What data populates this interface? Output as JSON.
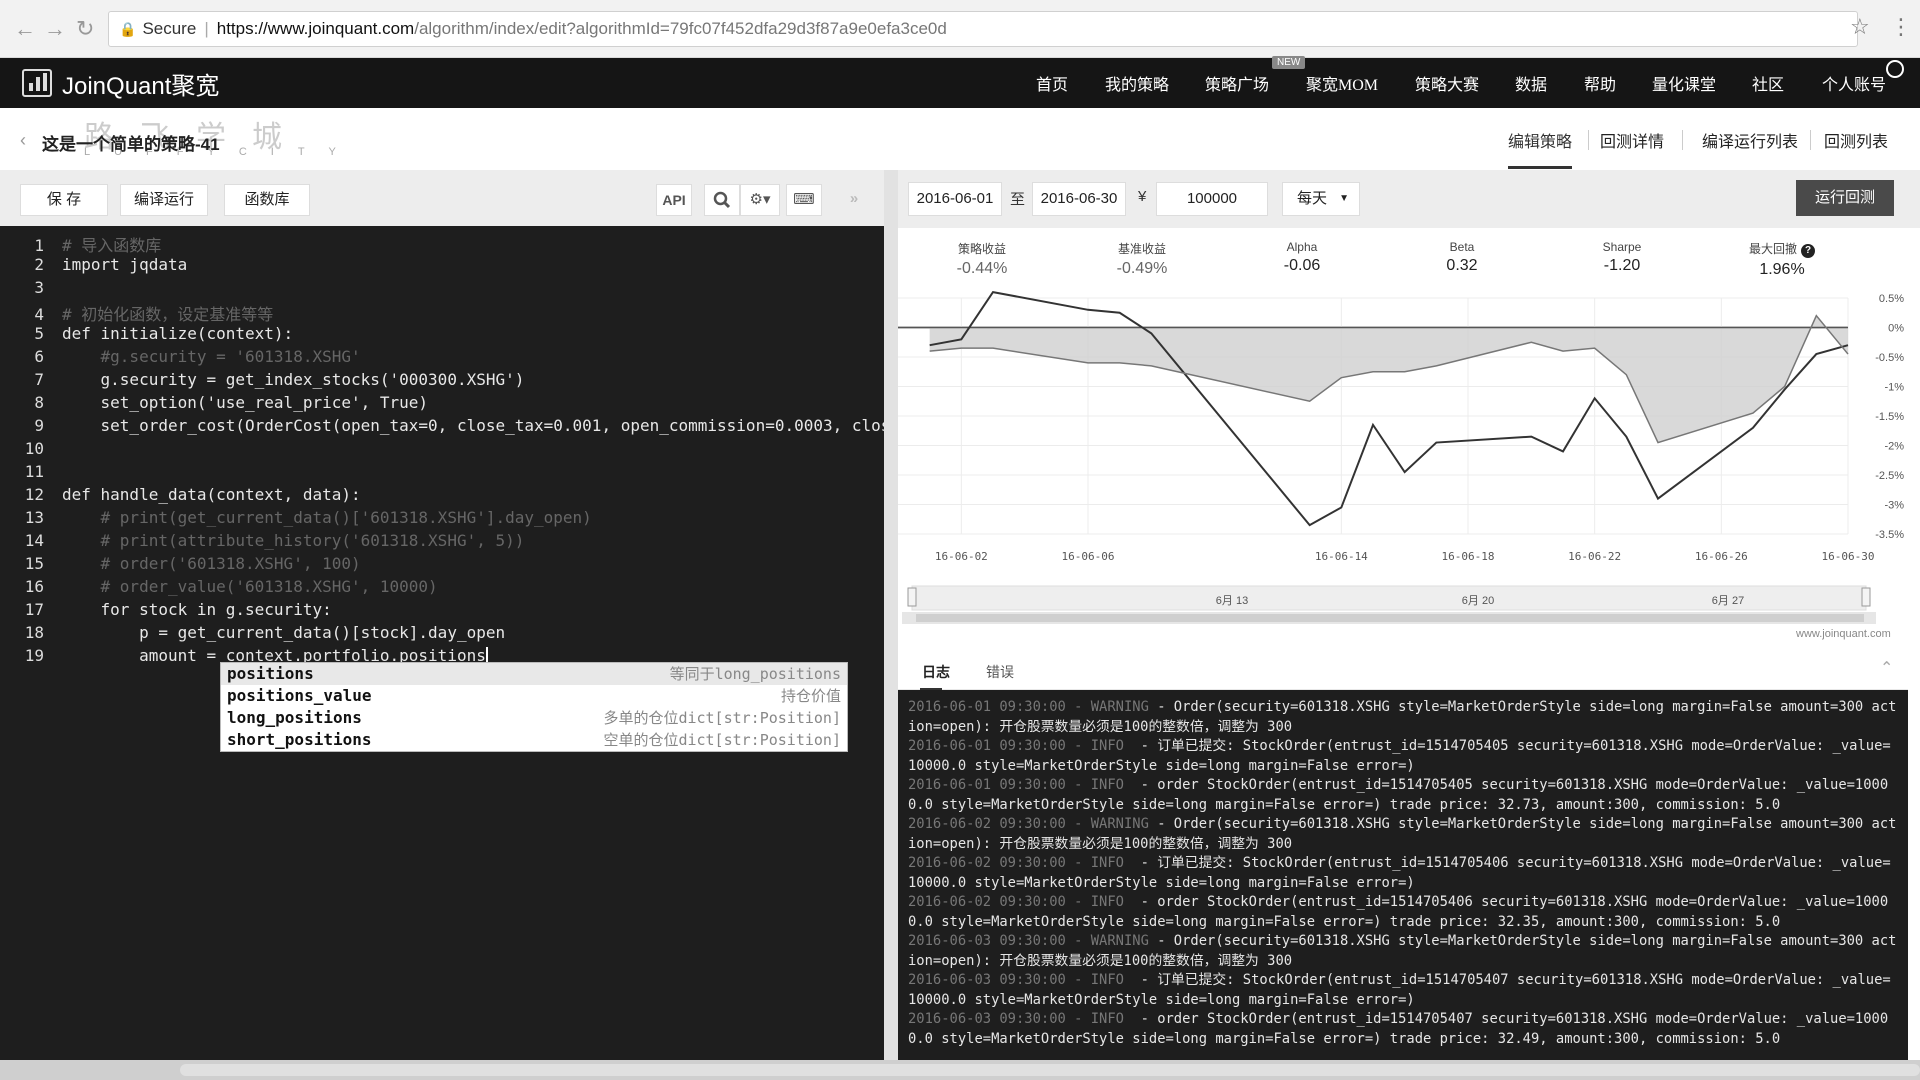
{
  "browser": {
    "secure_label": "Secure",
    "url_host": "https://www.joinquant.com",
    "url_path": "/algorithm/index/edit?algorithmId=79fc07f452dfa29d3f87a9e0efa3ce0d"
  },
  "topnav": {
    "brand": "JoinQuant聚宽",
    "items": [
      "首页",
      "我的策略",
      "策略广场",
      "聚宽MOM",
      "策略大赛",
      "数据",
      "帮助",
      "量化课堂",
      "社区",
      "个人账号"
    ],
    "new_tag": "NEW"
  },
  "page": {
    "strategy_title": "这是一个简单的策略-41",
    "watermark_cn": "路飞学城",
    "watermark_en": "LUFFYCITY",
    "tabs": [
      "编辑策略",
      "回测详情",
      "编译运行列表",
      "回测列表"
    ]
  },
  "editor_toolbar": {
    "save": "保 存",
    "compile_run": "编译运行",
    "library": "函数库",
    "api": "API"
  },
  "code_lines": [
    {
      "n": "1",
      "text": "# 导入函数库",
      "style": "cm"
    },
    {
      "n": "2",
      "text": "import jqdata",
      "style": ""
    },
    {
      "n": "3",
      "text": "",
      "style": ""
    },
    {
      "n": "4",
      "text": "# 初始化函数，设定基准等等",
      "style": "cm"
    },
    {
      "n": "5",
      "text": "def initialize(context):",
      "style": ""
    },
    {
      "n": "6",
      "text": "    #g.security = '601318.XSHG'",
      "style": "cm"
    },
    {
      "n": "7",
      "text": "    g.security = get_index_stocks('000300.XSHG')",
      "style": ""
    },
    {
      "n": "8",
      "text": "    set_option('use_real_price', True)",
      "style": ""
    },
    {
      "n": "9",
      "text": "    set_order_cost(OrderCost(open_tax=0, close_tax=0.001, open_commission=0.0003, close_",
      "style": ""
    },
    {
      "n": "10",
      "text": "",
      "style": ""
    },
    {
      "n": "11",
      "text": "",
      "style": ""
    },
    {
      "n": "12",
      "text": "def handle_data(context, data):",
      "style": ""
    },
    {
      "n": "13",
      "text": "    # print(get_current_data()['601318.XSHG'].day_open)",
      "style": "cm"
    },
    {
      "n": "14",
      "text": "    # print(attribute_history('601318.XSHG', 5))",
      "style": "cm"
    },
    {
      "n": "15",
      "text": "    # order('601318.XSHG', 100)",
      "style": "cm"
    },
    {
      "n": "16",
      "text": "    # order_value('601318.XSHG', 10000)",
      "style": "cm"
    },
    {
      "n": "17",
      "text": "    for stock in g.security:",
      "style": ""
    },
    {
      "n": "18",
      "text": "        p = get_current_data()[stock].day_open",
      "style": ""
    },
    {
      "n": "19",
      "text": "        amount = context.portfolio.positions",
      "style": ""
    }
  ],
  "autocomplete": [
    {
      "key": "positions",
      "desc": "等同于long_positions"
    },
    {
      "key": "positions_value",
      "desc": "持仓价值"
    },
    {
      "key": "long_positions",
      "desc": "多单的仓位dict[str:Position]"
    },
    {
      "key": "short_positions",
      "desc": "空单的仓位dict[str:Position]"
    }
  ],
  "backtest": {
    "start_date": "2016-06-01",
    "to_label": "至",
    "end_date": "2016-06-30",
    "currency_symbol": "¥",
    "capital": "100000",
    "frequency": "每天",
    "run_button": "运行回测"
  },
  "metrics": [
    {
      "label": "策略收益",
      "value": "-0.44%"
    },
    {
      "label": "基准收益",
      "value": "-0.49%"
    },
    {
      "label": "Alpha",
      "value": "-0.06"
    },
    {
      "label": "Beta",
      "value": "0.32"
    },
    {
      "label": "Sharpe",
      "value": "-1.20"
    },
    {
      "label": "最大回撤",
      "value": "1.96%"
    }
  ],
  "chart_data": {
    "type": "line",
    "x": [
      "16-06-01",
      "16-06-02",
      "16-06-03",
      "16-06-06",
      "16-06-07",
      "16-06-08",
      "16-06-13",
      "16-06-14",
      "16-06-15",
      "16-06-16",
      "16-06-17",
      "16-06-20",
      "16-06-21",
      "16-06-22",
      "16-06-23",
      "16-06-24",
      "16-06-27",
      "16-06-28",
      "16-06-29",
      "16-06-30"
    ],
    "x_tick_labels": [
      "16-06-02",
      "16-06-06",
      "16-06-14",
      "16-06-18",
      "16-06-22",
      "16-06-26",
      "16-06-30"
    ],
    "y_tick_labels": [
      "0.5%",
      "0%",
      "-0.5%",
      "-1%",
      "-1.5%",
      "-2%",
      "-2.5%",
      "-3%",
      "-3.5%"
    ],
    "ylim": [
      -3.5,
      0.5
    ],
    "grid": true,
    "series": [
      {
        "values": [
          -0.3,
          -0.2,
          0.6,
          0.3,
          0.25,
          -0.1,
          -3.35,
          -3.05,
          -1.65,
          -2.45,
          -1.95,
          -1.85,
          -2.1,
          -1.2,
          -1.85,
          -2.9,
          -1.7,
          -1.05,
          -0.45,
          -0.3
        ],
        "color": "#333333"
      },
      {
        "values": [
          -0.4,
          -0.35,
          -0.35,
          -0.6,
          -0.6,
          -0.65,
          -1.25,
          -0.85,
          -0.75,
          -0.75,
          -0.65,
          -0.25,
          -0.4,
          -0.35,
          -0.8,
          -1.95,
          -1.45,
          -1.0,
          0.2,
          -0.45
        ],
        "color": "#777777",
        "fill": "#cfcfcf"
      }
    ],
    "navigator_labels": [
      "6月 13",
      "6月 20",
      "6月 27"
    ]
  },
  "watermark_url": "www.joinquant.com",
  "log": {
    "tabs": [
      "日志",
      "错误"
    ],
    "lines": [
      {
        "ts": "2016-06-01 09:30:00 - WARNING",
        "msg": " - Order(security=601318.XSHG style=MarketOrderStyle side=long margin=False amount=300 action=open): 开仓股票数量必须是100的整数倍，调整为 300"
      },
      {
        "ts": "2016-06-01 09:30:00 - INFO",
        "msg": "  - 订单已提交: StockOrder(entrust_id=1514705405 security=601318.XSHG mode=OrderValue: _value=10000.0 style=MarketOrderStyle side=long margin=False error=)"
      },
      {
        "ts": "2016-06-01 09:30:00 - INFO",
        "msg": "  - order StockOrder(entrust_id=1514705405 security=601318.XSHG mode=OrderValue: _value=10000.0 style=MarketOrderStyle side=long margin=False error=) trade price: 32.73, amount:300, commission: 5.0"
      },
      {
        "ts": "2016-06-02 09:30:00 - WARNING",
        "msg": " - Order(security=601318.XSHG style=MarketOrderStyle side=long margin=False amount=300 action=open): 开仓股票数量必须是100的整数倍，调整为 300"
      },
      {
        "ts": "2016-06-02 09:30:00 - INFO",
        "msg": "  - 订单已提交: StockOrder(entrust_id=1514705406 security=601318.XSHG mode=OrderValue: _value=10000.0 style=MarketOrderStyle side=long margin=False error=)"
      },
      {
        "ts": "2016-06-02 09:30:00 - INFO",
        "msg": "  - order StockOrder(entrust_id=1514705406 security=601318.XSHG mode=OrderValue: _value=10000.0 style=MarketOrderStyle side=long margin=False error=) trade price: 32.35, amount:300, commission: 5.0"
      },
      {
        "ts": "2016-06-03 09:30:00 - WARNING",
        "msg": " - Order(security=601318.XSHG style=MarketOrderStyle side=long margin=False amount=300 action=open): 开仓股票数量必须是100的整数倍，调整为 300"
      },
      {
        "ts": "2016-06-03 09:30:00 - INFO",
        "msg": "  - 订单已提交: StockOrder(entrust_id=1514705407 security=601318.XSHG mode=OrderValue: _value=10000.0 style=MarketOrderStyle side=long margin=False error=)"
      },
      {
        "ts": "2016-06-03 09:30:00 - INFO",
        "msg": "  - order StockOrder(entrust_id=1514705407 security=601318.XSHG mode=OrderValue: _value=10000.0 style=MarketOrderStyle side=long margin=False error=) trade price: 32.49, amount:300, commission: 5.0"
      }
    ]
  }
}
